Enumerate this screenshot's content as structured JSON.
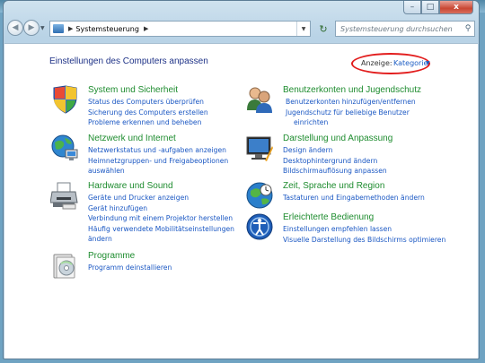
{
  "window": {
    "caption_buttons": {
      "minimize": "–",
      "maximize": "□",
      "close": "x"
    }
  },
  "nav": {
    "back_glyph": "◀",
    "forward_glyph": "▶",
    "address": {
      "icon": "control-panel-icon",
      "path": "Systemsteuerung"
    },
    "refresh_glyph": "↻",
    "search": {
      "placeholder": "Systemsteuerung durchsuchen",
      "icon": "search-icon"
    }
  },
  "page": {
    "title": "Einstellungen des Computers anpassen",
    "view": {
      "label": "Anzeige:",
      "value": "Kategorie",
      "highlight_color": "#e21d1d"
    }
  },
  "categories": [
    {
      "icon": "shield-flag-icon",
      "title": "System und Sicherheit",
      "links": [
        "Status des Computers überprüfen",
        "Sicherung des Computers erstellen",
        "Probleme erkennen und beheben"
      ]
    },
    {
      "icon": "network-globe-icon",
      "title": "Netzwerk und Internet",
      "links": [
        "Netzwerkstatus und -aufgaben anzeigen",
        "Heimnetzgruppen- und Freigabeoptionen",
        "auswählen"
      ]
    },
    {
      "icon": "printer-icon",
      "title": "Hardware und Sound",
      "links": [
        "Geräte und Drucker anzeigen",
        "Gerät hinzufügen",
        "Verbindung mit einem Projektor herstellen",
        "Häufig verwendete Mobilitätseinstellungen",
        "ändern"
      ]
    },
    {
      "icon": "programs-icon",
      "title": "Programme",
      "links": [
        "Programm deinstallieren"
      ]
    },
    {
      "icon": "user-accounts-icon",
      "title": "Benutzerkonten und Jugendschutz",
      "links": [
        "Benutzerkonten hinzufügen/entfernen",
        "Jugendschutz für beliebige Benutzer",
        "einrichten"
      ]
    },
    {
      "icon": "appearance-icon",
      "title": "Darstellung und Anpassung",
      "links": [
        "Design ändern",
        "Desktophintergrund ändern",
        "Bildschirmauflösung anpassen"
      ]
    },
    {
      "icon": "clock-globe-icon",
      "title": "Zeit, Sprache und Region",
      "links": [
        "Tastaturen und Eingabemethoden ändern"
      ]
    },
    {
      "icon": "ease-of-access-icon",
      "title": "Erleichterte Bedienung",
      "links": [
        "Einstellungen empfehlen lassen",
        "Visuelle Darstellung des Bildschirms optimieren"
      ]
    }
  ]
}
